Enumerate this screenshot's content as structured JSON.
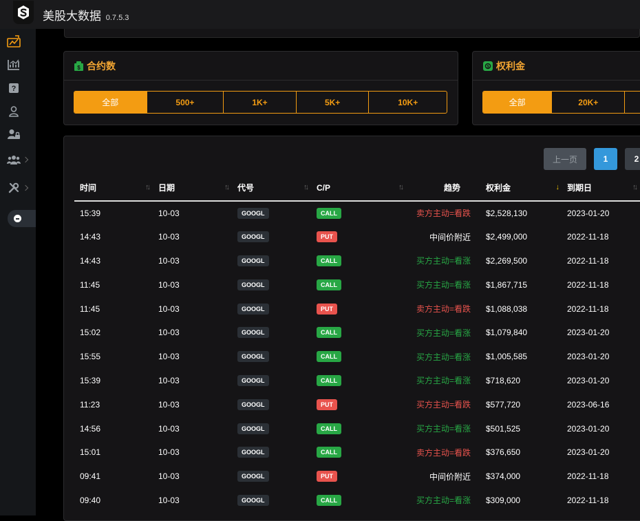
{
  "app": {
    "title": "美股大数据",
    "version": "0.7.5.3"
  },
  "colors": {
    "accent": "#f39c12",
    "call": "#28a745",
    "put": "#e8534d",
    "bullish": "#28a745",
    "bearish": "#e8534d",
    "neutral": "#ffffff",
    "page_active": "#3498db"
  },
  "sidebar": {
    "items": [
      {
        "icon": "chart-flow-icon",
        "active": true
      },
      {
        "icon": "line-chart-icon"
      },
      {
        "icon": "question-icon"
      },
      {
        "icon": "user-icon"
      },
      {
        "icon": "user-lock-icon"
      },
      {
        "icon": "users-icon",
        "expandable": true
      },
      {
        "icon": "tools-icon",
        "expandable": true
      }
    ]
  },
  "contracts_card": {
    "title": "合约数",
    "icon": "money-icon",
    "options": [
      "全部",
      "500+",
      "1K+",
      "5K+",
      "10K+"
    ],
    "selected": "全部"
  },
  "premium_card": {
    "title": "权利金",
    "icon": "money-bill-icon",
    "options": [
      "全部",
      "20K+"
    ],
    "selected": "全部"
  },
  "pagination": {
    "prev_label": "上一页",
    "pages": [
      "1",
      "2"
    ],
    "current": "1"
  },
  "table": {
    "columns": [
      "时间",
      "日期",
      "代号",
      "C/P",
      "趋势",
      "权利金",
      "到期日"
    ],
    "sorted_column": "权利金",
    "rows": [
      {
        "time": "15:39",
        "date": "10-03",
        "ticker": "GOOGL",
        "cp": "CALL",
        "trend": "卖方主动=看跌",
        "trend_type": "bearish",
        "premium": "$2,528,130",
        "expiry": "2023-01-20"
      },
      {
        "time": "14:43",
        "date": "10-03",
        "ticker": "GOOGL",
        "cp": "PUT",
        "trend": "中间价附近",
        "trend_type": "neutral",
        "premium": "$2,499,000",
        "expiry": "2022-11-18"
      },
      {
        "time": "14:43",
        "date": "10-03",
        "ticker": "GOOGL",
        "cp": "CALL",
        "trend": "买方主动=看涨",
        "trend_type": "bullish",
        "premium": "$2,269,500",
        "expiry": "2022-11-18"
      },
      {
        "time": "11:45",
        "date": "10-03",
        "ticker": "GOOGL",
        "cp": "CALL",
        "trend": "买方主动=看涨",
        "trend_type": "bullish",
        "premium": "$1,867,715",
        "expiry": "2022-11-18"
      },
      {
        "time": "11:45",
        "date": "10-03",
        "ticker": "GOOGL",
        "cp": "PUT",
        "trend": "卖方主动=看跌",
        "trend_type": "bullish",
        "premium": "$1,088,038",
        "expiry": "2022-11-18"
      },
      {
        "time": "15:02",
        "date": "10-03",
        "ticker": "GOOGL",
        "cp": "CALL",
        "trend": "买方主动=看涨",
        "trend_type": "bullish",
        "premium": "$1,079,840",
        "expiry": "2023-01-20"
      },
      {
        "time": "15:55",
        "date": "10-03",
        "ticker": "GOOGL",
        "cp": "CALL",
        "trend": "买方主动=看涨",
        "trend_type": "bullish",
        "premium": "$1,005,585",
        "expiry": "2023-01-20"
      },
      {
        "time": "15:39",
        "date": "10-03",
        "ticker": "GOOGL",
        "cp": "CALL",
        "trend": "买方主动=看涨",
        "trend_type": "bullish",
        "premium": "$718,620",
        "expiry": "2023-01-20"
      },
      {
        "time": "11:23",
        "date": "10-03",
        "ticker": "GOOGL",
        "cp": "PUT",
        "trend": "买方主动=看跌",
        "trend_type": "bearish",
        "premium": "$577,720",
        "expiry": "2023-06-16"
      },
      {
        "time": "14:56",
        "date": "10-03",
        "ticker": "GOOGL",
        "cp": "CALL",
        "trend": "买方主动=看涨",
        "trend_type": "bullish",
        "premium": "$501,525",
        "expiry": "2023-01-20"
      },
      {
        "time": "15:01",
        "date": "10-03",
        "ticker": "GOOGL",
        "cp": "CALL",
        "trend": "卖方主动=看跌",
        "trend_type": "bearish",
        "premium": "$376,650",
        "expiry": "2023-01-20"
      },
      {
        "time": "09:41",
        "date": "10-03",
        "ticker": "GOOGL",
        "cp": "PUT",
        "trend": "中间价附近",
        "trend_type": "neutral",
        "premium": "$374,000",
        "expiry": "2022-11-18"
      },
      {
        "time": "09:40",
        "date": "10-03",
        "ticker": "GOOGL",
        "cp": "CALL",
        "trend": "买方主动=看涨",
        "trend_type": "bullish",
        "premium": "$309,000",
        "expiry": "2022-11-18"
      }
    ]
  }
}
